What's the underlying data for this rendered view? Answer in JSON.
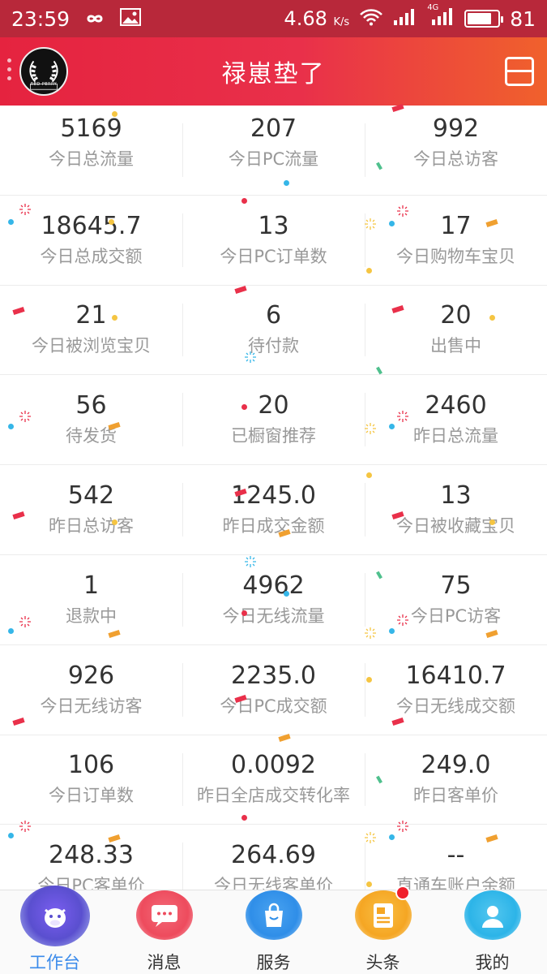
{
  "status_bar": {
    "time": "23:59",
    "speed": "4.68",
    "speed_unit": "K/s",
    "network": "4G",
    "battery": "81",
    "battery_level": 0.81
  },
  "header": {
    "logo_text": "RED PERRY",
    "title": "禄崽垫了"
  },
  "stats": [
    [
      {
        "value": "5169",
        "label": "今日总流量"
      },
      {
        "value": "207",
        "label": "今日PC流量"
      },
      {
        "value": "992",
        "label": "今日总访客"
      }
    ],
    [
      {
        "value": "18645.7",
        "label": "今日总成交额"
      },
      {
        "value": "13",
        "label": "今日PC订单数"
      },
      {
        "value": "17",
        "label": "今日购物车宝贝"
      }
    ],
    [
      {
        "value": "21",
        "label": "今日被浏览宝贝"
      },
      {
        "value": "6",
        "label": "待付款"
      },
      {
        "value": "20",
        "label": "出售中"
      }
    ],
    [
      {
        "value": "56",
        "label": "待发货"
      },
      {
        "value": "20",
        "label": "已橱窗推荐"
      },
      {
        "value": "2460",
        "label": "昨日总流量"
      }
    ],
    [
      {
        "value": "542",
        "label": "昨日总访客"
      },
      {
        "value": "1245.0",
        "label": "昨日成交金额"
      },
      {
        "value": "13",
        "label": "今日被收藏宝贝"
      }
    ],
    [
      {
        "value": "1",
        "label": "退款中"
      },
      {
        "value": "4962",
        "label": "今日无线流量"
      },
      {
        "value": "75",
        "label": "今日PC访客"
      }
    ],
    [
      {
        "value": "926",
        "label": "今日无线访客"
      },
      {
        "value": "2235.0",
        "label": "今日PC成交额"
      },
      {
        "value": "16410.7",
        "label": "今日无线成交额"
      }
    ],
    [
      {
        "value": "106",
        "label": "今日订单数"
      },
      {
        "value": "0.0092",
        "label": "昨日全店成交转化率"
      },
      {
        "value": "249.0",
        "label": "昨日客单价"
      }
    ],
    [
      {
        "value": "248.33",
        "label": "今日PC客单价"
      },
      {
        "value": "264.69",
        "label": "今日无线客单价"
      },
      {
        "value": "--",
        "label": "直通车账户余额"
      }
    ]
  ],
  "tabs": [
    {
      "label": "工作台",
      "icon": "cow-icon",
      "color": "#5a4fcf"
    },
    {
      "label": "消息",
      "icon": "message-icon",
      "color": "#ee4b5d"
    },
    {
      "label": "服务",
      "icon": "shopping-bag-icon",
      "color": "#2f8ee8"
    },
    {
      "label": "头条",
      "icon": "news-icon",
      "color": "#f5a623"
    },
    {
      "label": "我的",
      "icon": "user-icon",
      "color": "#2cb4e8"
    }
  ],
  "colors": {
    "header_start": "#e5233f",
    "header_end": "#f0612c",
    "active_tab": "#3b8beb"
  }
}
